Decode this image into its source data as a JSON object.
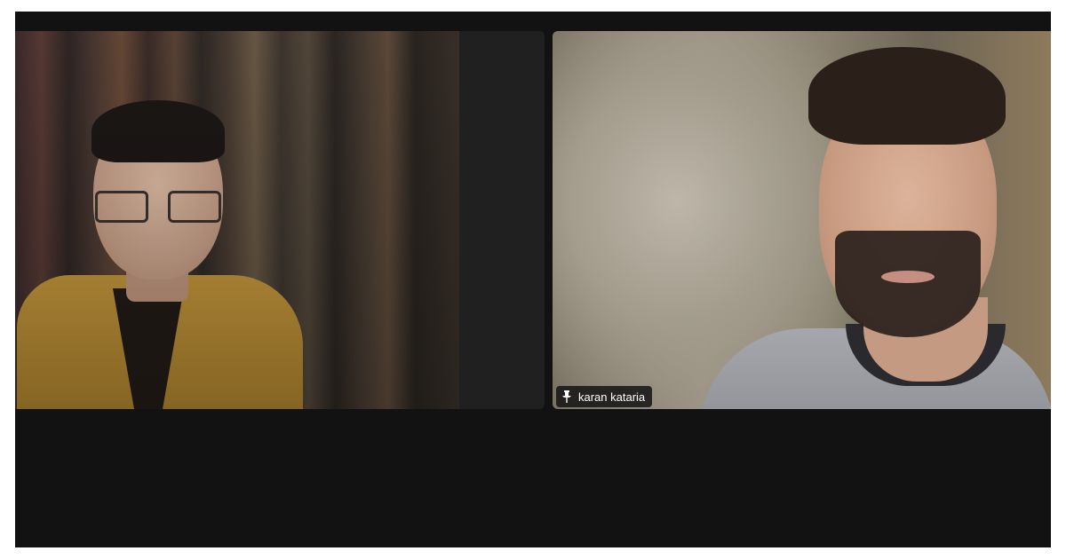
{
  "meeting": {
    "background_color": "#121212",
    "participants": [
      {
        "id": "left",
        "name": "",
        "name_tag_visible": false,
        "pinned": false
      },
      {
        "id": "right",
        "name": "karan kataria",
        "name_tag_visible": true,
        "pinned": true,
        "pin_icon": "pin-icon"
      }
    ]
  }
}
